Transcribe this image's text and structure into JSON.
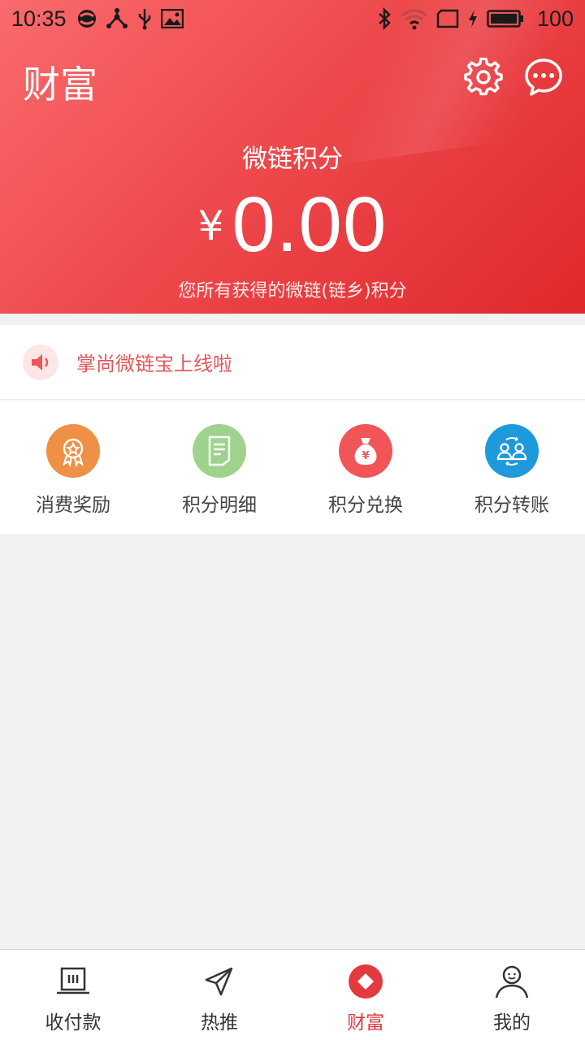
{
  "status_bar": {
    "time": "10:35",
    "battery_level": "100"
  },
  "header": {
    "title": "财富",
    "balance_label": "微链积分",
    "currency_symbol": "¥",
    "balance_amount": "0.00",
    "balance_description": "您所有获得的微链(链乡)积分"
  },
  "notice": {
    "text": "掌尚微链宝上线啦"
  },
  "features": [
    {
      "label": "消费奖励",
      "icon": "badge-icon",
      "color": "#ee9045"
    },
    {
      "label": "积分明细",
      "icon": "document-icon",
      "color": "#9fd28c"
    },
    {
      "label": "积分兑换",
      "icon": "money-bag-icon",
      "color": "#f15558"
    },
    {
      "label": "积分转账",
      "icon": "transfer-icon",
      "color": "#1e99dc"
    }
  ],
  "bottom_nav": {
    "active_index": 2,
    "items": [
      {
        "label": "收付款",
        "icon": "cashier-icon"
      },
      {
        "label": "热推",
        "icon": "paper-plane-icon"
      },
      {
        "label": "财富",
        "icon": "wealth-icon"
      },
      {
        "label": "我的",
        "icon": "person-icon"
      }
    ]
  },
  "colors": {
    "brand": "#e8363a",
    "active_tab": "#e23a3e",
    "notice_text": "#e2575b"
  }
}
